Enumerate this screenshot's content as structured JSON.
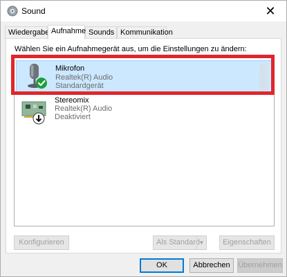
{
  "window": {
    "title": "Sound",
    "close_glyph": "✕"
  },
  "tabs": [
    {
      "label": "Wiedergabe",
      "active": false
    },
    {
      "label": "Aufnahme",
      "active": true
    },
    {
      "label": "Sounds",
      "active": false
    },
    {
      "label": "Kommunikation",
      "active": false
    }
  ],
  "panel": {
    "instruction": "Wählen Sie ein Aufnahmegerät aus, um die Einstellungen zu ändern:",
    "devices": [
      {
        "name": "Mikrofon",
        "driver": "Realtek(R) Audio",
        "status": "Standardgerät",
        "icon": "microphone-icon",
        "badge": "check-badge-icon",
        "selected": true
      },
      {
        "name": "Stereomix",
        "driver": "Realtek(R) Audio",
        "status": "Deaktiviert",
        "icon": "circuit-board-icon",
        "badge": "disabled-down-arrow-icon",
        "selected": false
      }
    ],
    "buttons": {
      "configure": "Konfigurieren",
      "set_default": "Als Standard",
      "properties": "Eigenschaften"
    }
  },
  "footer": {
    "ok": "OK",
    "cancel": "Abbrechen",
    "apply": "Übernehmen"
  },
  "colors": {
    "highlight": "#e0262d",
    "selection": "#cce8ff",
    "check_badge": "#1e9e3a",
    "default_button_border": "#0078d7"
  }
}
